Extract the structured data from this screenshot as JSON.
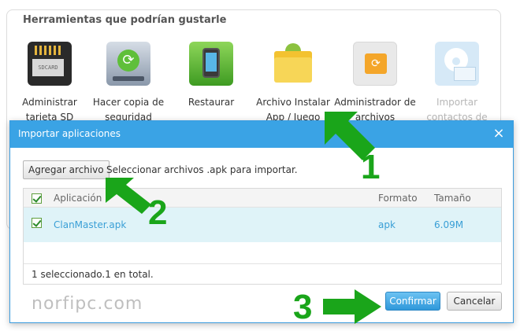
{
  "tools": {
    "title": "Herramientas que podrían gustarle",
    "items": [
      {
        "label": "Administrar tarjeta SD",
        "icon": "sd-card-icon",
        "card_text": "SDCARD"
      },
      {
        "label": "Hacer copia de seguridad",
        "icon": "backup-icon"
      },
      {
        "label": "Restaurar",
        "icon": "restore-phone-icon"
      },
      {
        "label": "Archivo Instalar App / Juego",
        "icon": "android-folder-icon"
      },
      {
        "label": "Administrador de archivos",
        "icon": "file-manager-icon"
      },
      {
        "label": "Importar contactos de Outlook",
        "icon": "outlook-contacts-icon"
      }
    ]
  },
  "dialog": {
    "title": "Importar aplicaciones",
    "close_icon": "×",
    "add_button": "Agregar archivo",
    "hint": "Seleccionar archivos .apk para importar.",
    "table": {
      "headers": {
        "app": "Aplicación",
        "format": "Formato",
        "size": "Tamaño"
      },
      "rows": [
        {
          "app": "ClanMaster.apk",
          "format": "apk",
          "size": "6.09M",
          "checked": true
        }
      ],
      "footer": "1 seleccionado.1 en total."
    },
    "confirm": "Confirmar",
    "cancel": "Cancelar"
  },
  "watermark": "norfipc.com",
  "annotations": {
    "step1": "1",
    "step2": "2",
    "step3": "3",
    "arrow_color": "#1aa51a"
  }
}
